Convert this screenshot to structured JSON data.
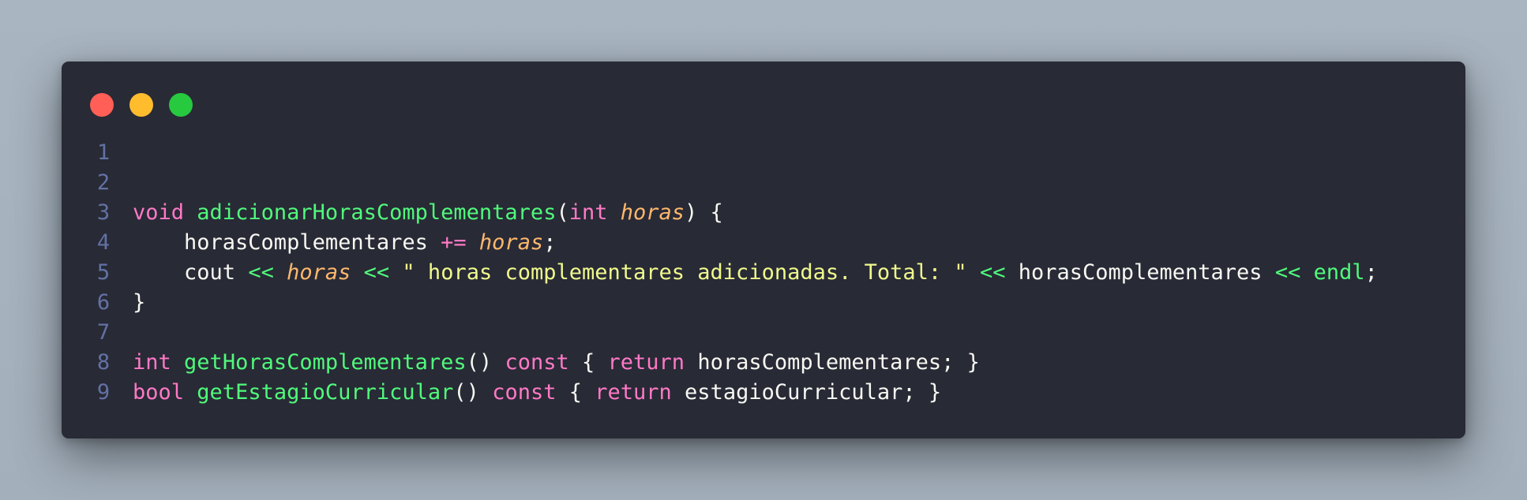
{
  "window": {
    "controls": [
      {
        "name": "close",
        "color": "#ff5f56"
      },
      {
        "name": "minimize",
        "color": "#ffbd2e"
      },
      {
        "name": "maximize",
        "color": "#27c93f"
      }
    ]
  },
  "theme": {
    "background": "#282a36",
    "line_number": "#6272a4",
    "default": "#f8f8f2",
    "keyword": "#ff79c6",
    "function": "#50fa7b",
    "parameter": "#ffb86c",
    "string": "#f1fa8c"
  },
  "code": {
    "lines": [
      {
        "number": "1",
        "tokens": []
      },
      {
        "number": "2",
        "tokens": []
      },
      {
        "number": "3",
        "tokens": [
          {
            "t": "void",
            "c": "k"
          },
          {
            "t": " ",
            "c": "d"
          },
          {
            "t": "adicionarHorasComplementares",
            "c": "f"
          },
          {
            "t": "(",
            "c": "d"
          },
          {
            "t": "int",
            "c": "k"
          },
          {
            "t": " ",
            "c": "d"
          },
          {
            "t": "horas",
            "c": "p"
          },
          {
            "t": ") {",
            "c": "d"
          }
        ]
      },
      {
        "number": "4",
        "tokens": [
          {
            "t": "    horasComplementares ",
            "c": "d"
          },
          {
            "t": "+=",
            "c": "k"
          },
          {
            "t": " ",
            "c": "d"
          },
          {
            "t": "horas",
            "c": "p"
          },
          {
            "t": ";",
            "c": "d"
          }
        ]
      },
      {
        "number": "5",
        "tokens": [
          {
            "t": "    cout ",
            "c": "d"
          },
          {
            "t": "<<",
            "c": "f"
          },
          {
            "t": " ",
            "c": "d"
          },
          {
            "t": "horas",
            "c": "p"
          },
          {
            "t": " ",
            "c": "d"
          },
          {
            "t": "<<",
            "c": "f"
          },
          {
            "t": " ",
            "c": "d"
          },
          {
            "t": "\" horas complementares adicionadas. Total: \"",
            "c": "s"
          },
          {
            "t": " ",
            "c": "d"
          },
          {
            "t": "<<",
            "c": "f"
          },
          {
            "t": " horasComplementares ",
            "c": "d"
          },
          {
            "t": "<<",
            "c": "f"
          },
          {
            "t": " ",
            "c": "d"
          },
          {
            "t": "endl",
            "c": "f"
          },
          {
            "t": ";",
            "c": "d"
          }
        ]
      },
      {
        "number": "6",
        "tokens": [
          {
            "t": "}",
            "c": "d"
          }
        ]
      },
      {
        "number": "7",
        "tokens": []
      },
      {
        "number": "8",
        "tokens": [
          {
            "t": "int",
            "c": "k"
          },
          {
            "t": " ",
            "c": "d"
          },
          {
            "t": "getHorasComplementares",
            "c": "f"
          },
          {
            "t": "() ",
            "c": "d"
          },
          {
            "t": "const",
            "c": "k"
          },
          {
            "t": " { ",
            "c": "d"
          },
          {
            "t": "return",
            "c": "k"
          },
          {
            "t": " horasComplementares; }",
            "c": "d"
          }
        ]
      },
      {
        "number": "9",
        "tokens": [
          {
            "t": "bool",
            "c": "k"
          },
          {
            "t": " ",
            "c": "d"
          },
          {
            "t": "getEstagioCurricular",
            "c": "f"
          },
          {
            "t": "() ",
            "c": "d"
          },
          {
            "t": "const",
            "c": "k"
          },
          {
            "t": " { ",
            "c": "d"
          },
          {
            "t": "return",
            "c": "k"
          },
          {
            "t": " estagioCurricular; }",
            "c": "d"
          }
        ]
      }
    ]
  }
}
